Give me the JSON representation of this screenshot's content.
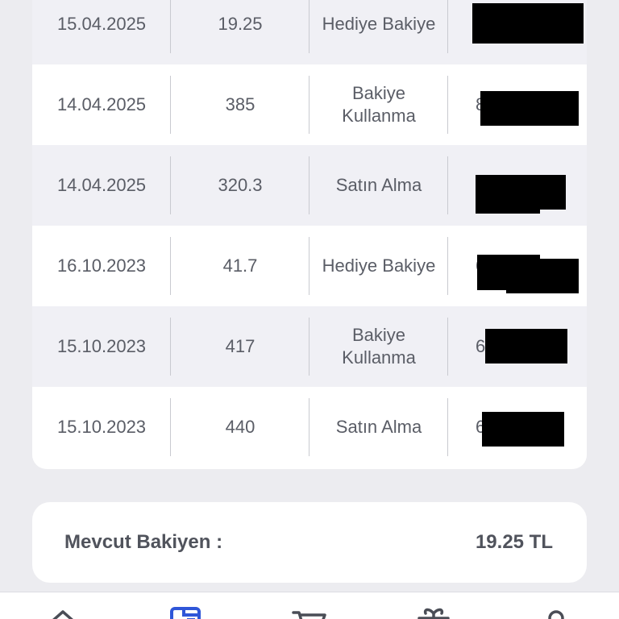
{
  "transactions": [
    {
      "date": "15.04.2025",
      "amount": "19.25",
      "type": "Hediye Bakiye",
      "ref_visible": ""
    },
    {
      "date": "14.04.2025",
      "amount": "385",
      "type": "Bakiye Kullanma",
      "ref_visible": "8"
    },
    {
      "date": "14.04.2025",
      "amount": "320.3",
      "type": "Satın Alma",
      "ref_visible": ""
    },
    {
      "date": "16.10.2023",
      "amount": "41.7",
      "type": "Hediye Bakiye",
      "ref_visible": "6"
    },
    {
      "date": "15.10.2023",
      "amount": "417",
      "type": "Bakiye Kullanma",
      "ref_visible": "6"
    },
    {
      "date": "15.10.2023",
      "amount": "440",
      "type": "Satın Alma",
      "ref_visible": "6"
    }
  ],
  "balance": {
    "label": "Mevcut Bakiyen :",
    "value": "19.25 TL"
  },
  "nav": {
    "items": [
      {
        "icon": "home-icon",
        "active": false
      },
      {
        "icon": "wallet-icon",
        "active": true
      },
      {
        "icon": "cart-icon",
        "active": false
      },
      {
        "icon": "gift-icon",
        "active": false
      },
      {
        "icon": "user-icon",
        "active": false
      }
    ],
    "active_color": "#2f56d8",
    "inactive_color": "#4a4d56"
  }
}
